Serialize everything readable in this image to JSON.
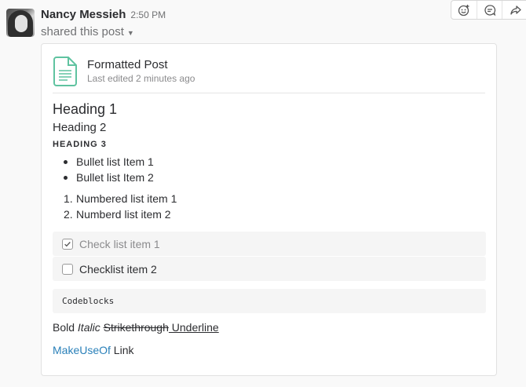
{
  "message": {
    "author": "Nancy Messieh",
    "timestamp": "2:50 PM",
    "shared_text": "shared this post"
  },
  "actions": [
    {
      "name": "add-reaction-icon"
    },
    {
      "name": "comment-icon"
    },
    {
      "name": "share-icon"
    }
  ],
  "post": {
    "title": "Formatted Post",
    "subtitle": "Last edited 2 minutes ago",
    "heading1": "Heading 1",
    "heading2": "Heading 2",
    "heading3": "HEADING 3",
    "bullets": [
      "Bullet list Item 1",
      "Bullet list Item 2"
    ],
    "numbered": [
      {
        "num": "1.",
        "text": "Numbered list item 1"
      },
      {
        "num": "2.",
        "text": "Numberd list item 2"
      }
    ],
    "checklist": [
      {
        "text": "Check list item 1",
        "checked": true
      },
      {
        "text": "Checklist item 2",
        "checked": false
      }
    ],
    "code": "Codeblocks",
    "format": {
      "bold": "Bold",
      "italic": "Italic",
      "strike": "Strikethrough",
      "underline": " Underline"
    },
    "link": {
      "anchor": "MakeUseOf",
      "rest": " Link"
    }
  },
  "colors": {
    "link": "#2a80b9",
    "doc_icon": "#5fc3a0"
  }
}
